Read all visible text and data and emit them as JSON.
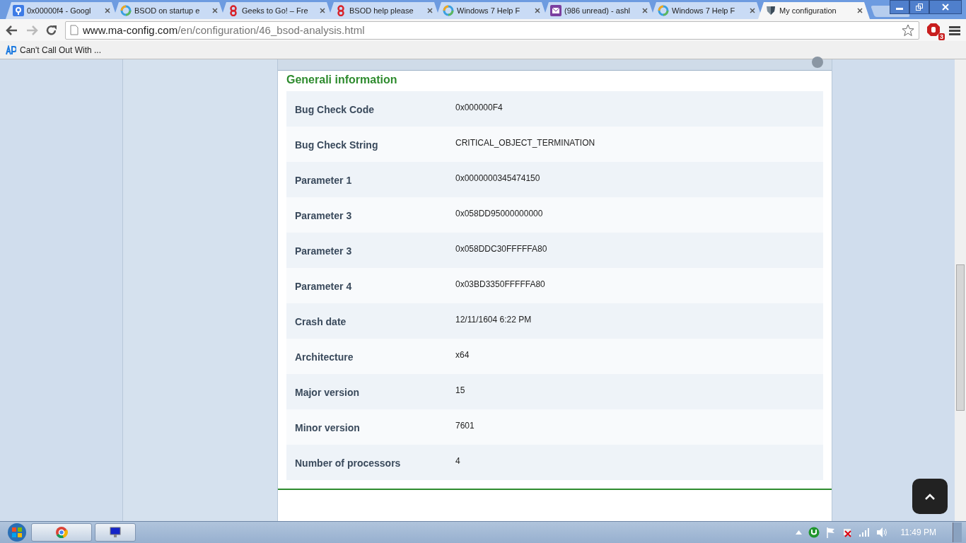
{
  "browser": {
    "tabs": [
      {
        "title": "0x00000f4 - Googl",
        "kind": "google",
        "selected": false
      },
      {
        "title": "BSOD on startup e",
        "kind": "ring",
        "selected": false
      },
      {
        "title": "Geeks to Go! – Fre",
        "kind": "geeks",
        "selected": false
      },
      {
        "title": "BSOD help please",
        "kind": "geeks",
        "selected": false
      },
      {
        "title": "Windows 7 Help F",
        "kind": "ring",
        "selected": false
      },
      {
        "title": "(986 unread) - ashl",
        "kind": "mail",
        "selected": false
      },
      {
        "title": "Windows 7 Help F",
        "kind": "ring",
        "selected": false
      },
      {
        "title": "My configuration",
        "kind": "config",
        "selected": true
      }
    ],
    "address": {
      "host": "www.ma-config.com",
      "path": "/en/configuration/46_bsod-analysis.html"
    },
    "extension_badge": "3",
    "bookmarks": [
      {
        "label": "Can't Call Out With ..."
      }
    ]
  },
  "section": {
    "title": "Generali information",
    "rows": [
      {
        "label": "Bug Check Code",
        "value": "0x000000F4"
      },
      {
        "label": "Bug Check String",
        "value": "CRITICAL_OBJECT_TERMINATION"
      },
      {
        "label": "Parameter 1",
        "value": "0x0000000345474150"
      },
      {
        "label": "Parameter 3",
        "value": "0x058DD95000000000"
      },
      {
        "label": "Parameter 3",
        "value": "0x058DDC30FFFFFA80"
      },
      {
        "label": "Parameter 4",
        "value": "0x03BD3350FFFFFA80"
      },
      {
        "label": "Crash date",
        "value": "12/11/1604 6:22 PM"
      },
      {
        "label": "Architecture",
        "value": "x64"
      },
      {
        "label": "Major version",
        "value": "15"
      },
      {
        "label": "Minor version",
        "value": "7601"
      },
      {
        "label": "Number of processors",
        "value": "4"
      }
    ]
  },
  "taskbar": {
    "clock": "11:49 PM"
  }
}
